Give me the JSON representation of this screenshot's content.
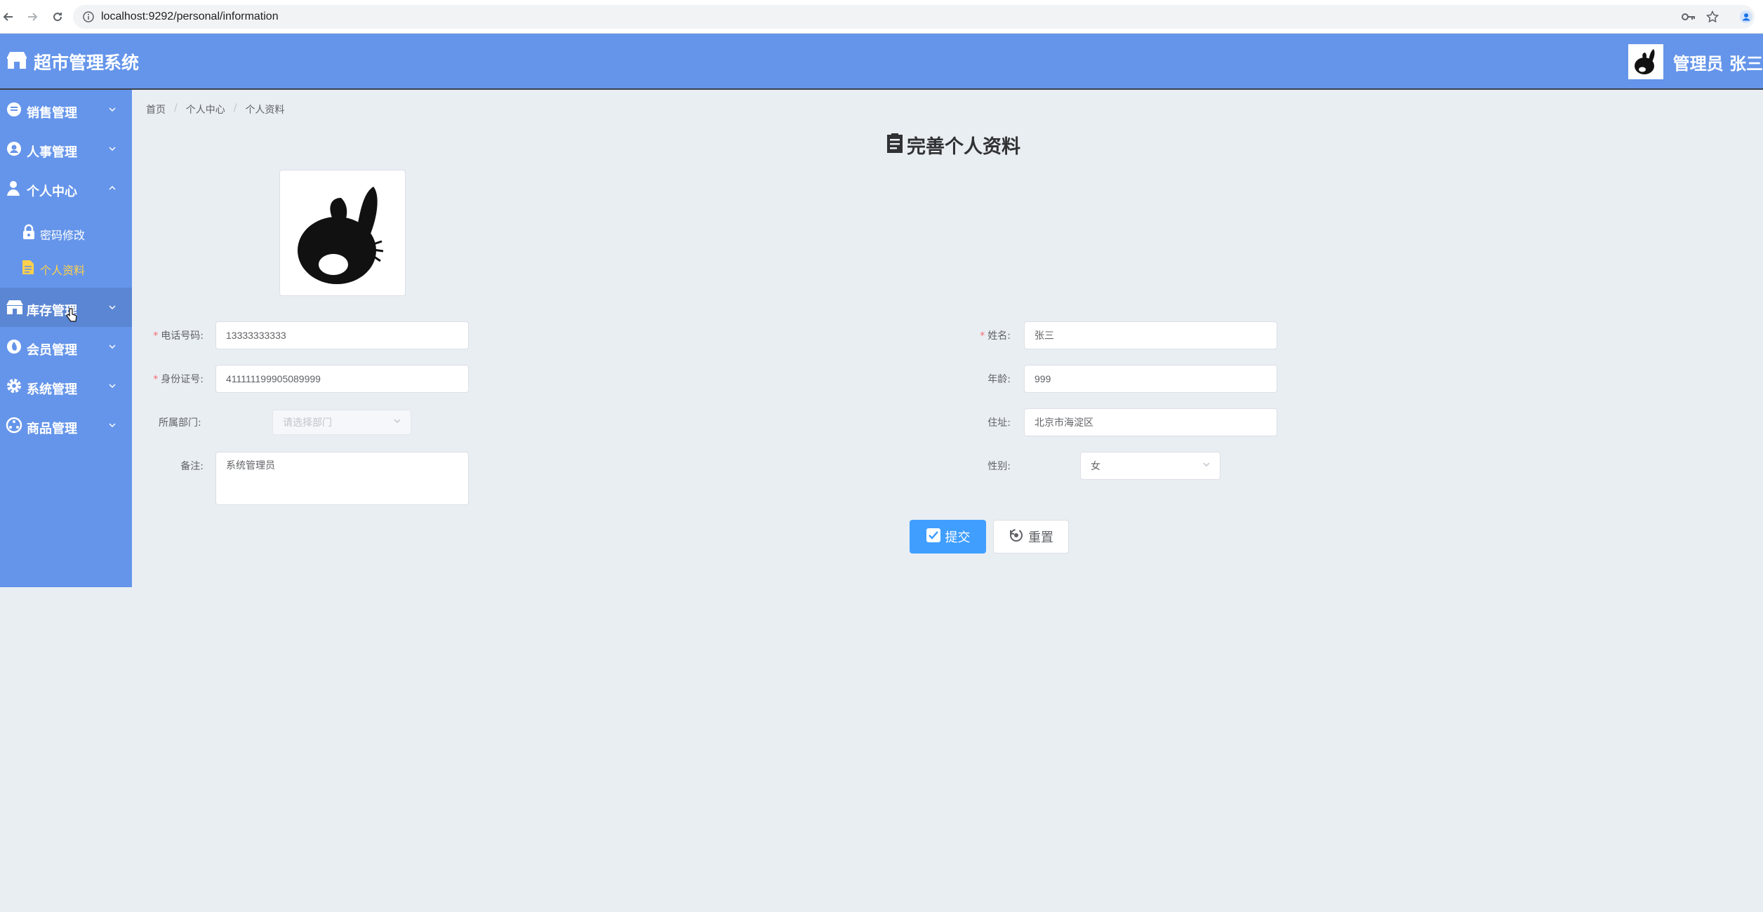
{
  "browser": {
    "url": "localhost:9292/personal/information"
  },
  "header": {
    "app_title": "超市管理系统",
    "user_label": "管理员 张三"
  },
  "sidebar": {
    "items": [
      {
        "label": "销售管理",
        "icon": "sales-icon",
        "expanded": false
      },
      {
        "label": "人事管理",
        "icon": "personnel-icon",
        "expanded": false
      },
      {
        "label": "个人中心",
        "icon": "user-icon",
        "expanded": true
      },
      {
        "label": "库存管理",
        "icon": "warehouse-icon",
        "expanded": false
      },
      {
        "label": "会员管理",
        "icon": "member-icon",
        "expanded": false
      },
      {
        "label": "系统管理",
        "icon": "gear-icon",
        "expanded": false
      },
      {
        "label": "商品管理",
        "icon": "goods-icon",
        "expanded": false
      }
    ],
    "submenu": [
      {
        "label": "密码修改",
        "icon": "lock-icon",
        "active": false
      },
      {
        "label": "个人资料",
        "icon": "document-icon",
        "active": true
      }
    ]
  },
  "breadcrumb": [
    "首页",
    "个人中心",
    "个人资料"
  ],
  "page": {
    "title": "完善个人资料"
  },
  "form": {
    "phone": {
      "label": "电话号码:",
      "value": "13333333333",
      "required": true
    },
    "id_card": {
      "label": "身份证号:",
      "value": "411111199905089999",
      "required": true
    },
    "department": {
      "label": "所属部门:",
      "placeholder": "请选择部门"
    },
    "remark": {
      "label": "备注:",
      "value": "系统管理员"
    },
    "name": {
      "label": "姓名:",
      "value": "张三",
      "required": true
    },
    "age": {
      "label": "年龄:",
      "value": "999"
    },
    "address": {
      "label": "住址:",
      "value": "北京市海淀区"
    },
    "gender": {
      "label": "性别:",
      "value": "女"
    }
  },
  "buttons": {
    "submit": "提交",
    "reset": "重置"
  },
  "colors": {
    "header_bg": "#6595ea",
    "primary": "#409eff",
    "active_submenu": "#ffd04b",
    "required": "#f56c6c"
  }
}
